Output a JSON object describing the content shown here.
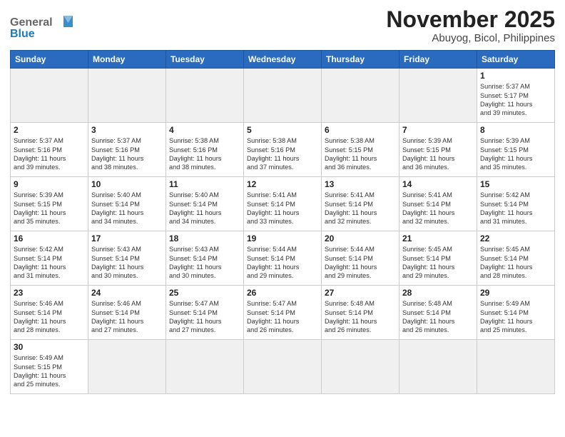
{
  "header": {
    "logo_general": "General",
    "logo_blue": "Blue",
    "title": "November 2025",
    "subtitle": "Abuyog, Bicol, Philippines"
  },
  "weekdays": [
    "Sunday",
    "Monday",
    "Tuesday",
    "Wednesday",
    "Thursday",
    "Friday",
    "Saturday"
  ],
  "days": [
    {
      "num": "",
      "info": ""
    },
    {
      "num": "",
      "info": ""
    },
    {
      "num": "",
      "info": ""
    },
    {
      "num": "",
      "info": ""
    },
    {
      "num": "",
      "info": ""
    },
    {
      "num": "",
      "info": ""
    },
    {
      "num": "1",
      "info": "Sunrise: 5:37 AM\nSunset: 5:17 PM\nDaylight: 11 hours\nand 39 minutes."
    },
    {
      "num": "2",
      "info": "Sunrise: 5:37 AM\nSunset: 5:16 PM\nDaylight: 11 hours\nand 39 minutes."
    },
    {
      "num": "3",
      "info": "Sunrise: 5:37 AM\nSunset: 5:16 PM\nDaylight: 11 hours\nand 38 minutes."
    },
    {
      "num": "4",
      "info": "Sunrise: 5:38 AM\nSunset: 5:16 PM\nDaylight: 11 hours\nand 38 minutes."
    },
    {
      "num": "5",
      "info": "Sunrise: 5:38 AM\nSunset: 5:16 PM\nDaylight: 11 hours\nand 37 minutes."
    },
    {
      "num": "6",
      "info": "Sunrise: 5:38 AM\nSunset: 5:15 PM\nDaylight: 11 hours\nand 36 minutes."
    },
    {
      "num": "7",
      "info": "Sunrise: 5:39 AM\nSunset: 5:15 PM\nDaylight: 11 hours\nand 36 minutes."
    },
    {
      "num": "8",
      "info": "Sunrise: 5:39 AM\nSunset: 5:15 PM\nDaylight: 11 hours\nand 35 minutes."
    },
    {
      "num": "9",
      "info": "Sunrise: 5:39 AM\nSunset: 5:15 PM\nDaylight: 11 hours\nand 35 minutes."
    },
    {
      "num": "10",
      "info": "Sunrise: 5:40 AM\nSunset: 5:14 PM\nDaylight: 11 hours\nand 34 minutes."
    },
    {
      "num": "11",
      "info": "Sunrise: 5:40 AM\nSunset: 5:14 PM\nDaylight: 11 hours\nand 34 minutes."
    },
    {
      "num": "12",
      "info": "Sunrise: 5:41 AM\nSunset: 5:14 PM\nDaylight: 11 hours\nand 33 minutes."
    },
    {
      "num": "13",
      "info": "Sunrise: 5:41 AM\nSunset: 5:14 PM\nDaylight: 11 hours\nand 32 minutes."
    },
    {
      "num": "14",
      "info": "Sunrise: 5:41 AM\nSunset: 5:14 PM\nDaylight: 11 hours\nand 32 minutes."
    },
    {
      "num": "15",
      "info": "Sunrise: 5:42 AM\nSunset: 5:14 PM\nDaylight: 11 hours\nand 31 minutes."
    },
    {
      "num": "16",
      "info": "Sunrise: 5:42 AM\nSunset: 5:14 PM\nDaylight: 11 hours\nand 31 minutes."
    },
    {
      "num": "17",
      "info": "Sunrise: 5:43 AM\nSunset: 5:14 PM\nDaylight: 11 hours\nand 30 minutes."
    },
    {
      "num": "18",
      "info": "Sunrise: 5:43 AM\nSunset: 5:14 PM\nDaylight: 11 hours\nand 30 minutes."
    },
    {
      "num": "19",
      "info": "Sunrise: 5:44 AM\nSunset: 5:14 PM\nDaylight: 11 hours\nand 29 minutes."
    },
    {
      "num": "20",
      "info": "Sunrise: 5:44 AM\nSunset: 5:14 PM\nDaylight: 11 hours\nand 29 minutes."
    },
    {
      "num": "21",
      "info": "Sunrise: 5:45 AM\nSunset: 5:14 PM\nDaylight: 11 hours\nand 29 minutes."
    },
    {
      "num": "22",
      "info": "Sunrise: 5:45 AM\nSunset: 5:14 PM\nDaylight: 11 hours\nand 28 minutes."
    },
    {
      "num": "23",
      "info": "Sunrise: 5:46 AM\nSunset: 5:14 PM\nDaylight: 11 hours\nand 28 minutes."
    },
    {
      "num": "24",
      "info": "Sunrise: 5:46 AM\nSunset: 5:14 PM\nDaylight: 11 hours\nand 27 minutes."
    },
    {
      "num": "25",
      "info": "Sunrise: 5:47 AM\nSunset: 5:14 PM\nDaylight: 11 hours\nand 27 minutes."
    },
    {
      "num": "26",
      "info": "Sunrise: 5:47 AM\nSunset: 5:14 PM\nDaylight: 11 hours\nand 26 minutes."
    },
    {
      "num": "27",
      "info": "Sunrise: 5:48 AM\nSunset: 5:14 PM\nDaylight: 11 hours\nand 26 minutes."
    },
    {
      "num": "28",
      "info": "Sunrise: 5:48 AM\nSunset: 5:14 PM\nDaylight: 11 hours\nand 26 minutes."
    },
    {
      "num": "29",
      "info": "Sunrise: 5:49 AM\nSunset: 5:14 PM\nDaylight: 11 hours\nand 25 minutes."
    },
    {
      "num": "30",
      "info": "Sunrise: 5:49 AM\nSunset: 5:15 PM\nDaylight: 11 hours\nand 25 minutes."
    },
    {
      "num": "",
      "info": ""
    },
    {
      "num": "",
      "info": ""
    },
    {
      "num": "",
      "info": ""
    },
    {
      "num": "",
      "info": ""
    },
    {
      "num": "",
      "info": ""
    },
    {
      "num": "",
      "info": ""
    }
  ]
}
